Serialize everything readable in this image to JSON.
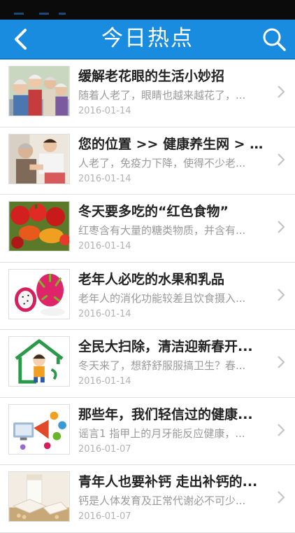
{
  "header": {
    "title": "今日热点",
    "back_icon": "chevron-left-icon",
    "search_icon": "search-icon",
    "color": "#1a8ce0"
  },
  "items": [
    {
      "title": "缓解老花眼的生活小妙招",
      "summary": "随着人老了，眼睛也越来越花了，...",
      "date": "2016-01-14",
      "thumb": "elderly-group-photo"
    },
    {
      "title": "您的位置 >> 健康养生网 > 护...",
      "summary": "人老了，免疫力下降，使得不少老...",
      "date": "2016-01-14",
      "thumb": "elderly-care-photo"
    },
    {
      "title": "冬天要多吃的“红色食物”",
      "summary": "红枣含有大量的糖类物质，并含有...",
      "date": "2016-01-14",
      "thumb": "red-vegetables-photo"
    },
    {
      "title": "老年人必吃的水果和乳品",
      "summary": "老年人的消化功能较差且饮食摄入...",
      "date": "2016-01-14",
      "thumb": "dragon-fruit-photo"
    },
    {
      "title": "全民大扫除，清洁迎新春开...",
      "summary": "冬天来了，想舒舒服服搞卫生？春...",
      "date": "2016-01-14",
      "thumb": "house-cleaning-illustration"
    },
    {
      "title": "那些年，我们轻信过的健康...",
      "summary": "谣言1 指甲上的月牙能反应健康，...",
      "date": "2016-01-07",
      "thumb": "health-rumors-illustration"
    },
    {
      "title": "青年人也要补钙 走出补钙的...",
      "summary": "钙是人体发育及正常代谢必不可少...",
      "date": "2016-01-07",
      "thumb": "milk-calcium-photo"
    }
  ]
}
